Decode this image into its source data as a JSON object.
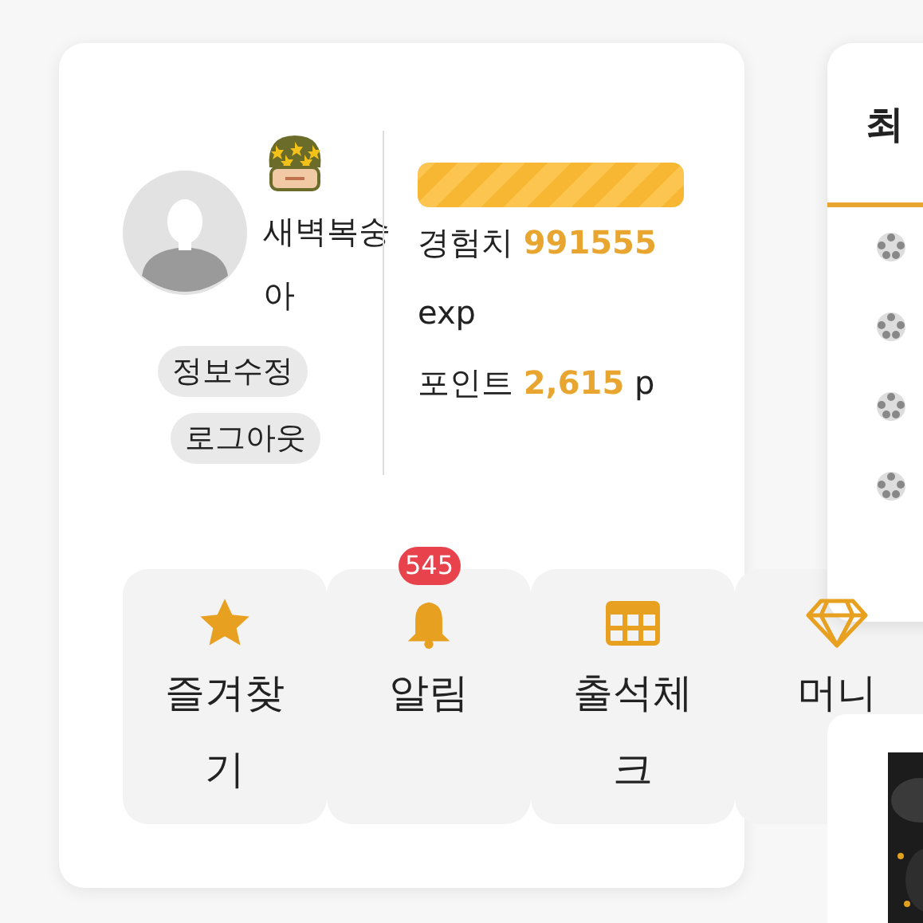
{
  "profile": {
    "nickname": "새벽복숭아",
    "buttons": [
      "정보수정",
      "로그아웃"
    ],
    "exp_bar": {
      "level": 1
    },
    "exp_label": "경험치",
    "exp_value": "991555",
    "exp_unit": "exp",
    "point_label": "포인트",
    "point_value": "2,615",
    "point_unit": "p"
  },
  "menu": [
    {
      "kind": "star",
      "label": "즐겨찾기"
    },
    {
      "kind": "bell",
      "label": "알림",
      "badge": "545"
    },
    {
      "kind": "grid",
      "label": "출석체크"
    },
    {
      "kind": "gem",
      "label": "머니"
    }
  ],
  "side_card": {
    "title": "최",
    "rows": [
      {
        "kind": "ball"
      },
      {
        "kind": "ball"
      },
      {
        "kind": "ball"
      },
      {
        "kind": "ball"
      }
    ]
  }
}
